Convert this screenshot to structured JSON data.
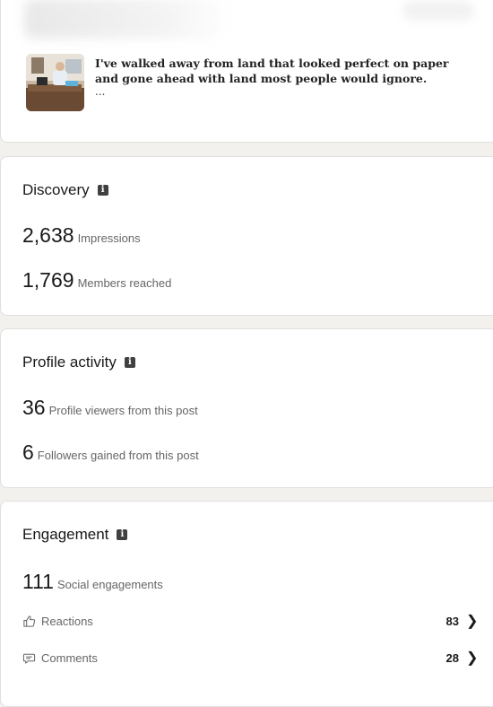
{
  "post": {
    "text": "I've walked away from land that looked perfect on paper and gone ahead with land most people would ignore.",
    "ellipsis": "..."
  },
  "discovery": {
    "title": "Discovery",
    "impressions_value": "2,638",
    "impressions_label": "Impressions",
    "members_value": "1,769",
    "members_label": "Members reached"
  },
  "profile_activity": {
    "title": "Profile activity",
    "viewers_value": "36",
    "viewers_label": "Profile viewers from this post",
    "followers_value": "6",
    "followers_label": "Followers gained from this post"
  },
  "engagement": {
    "title": "Engagement",
    "social_value": "111",
    "social_label": "Social engagements",
    "reactions_label": "Reactions",
    "reactions_count": "83",
    "comments_label": "Comments",
    "comments_count": "28"
  },
  "icons": {
    "info": "info-icon",
    "reactions": "thumbs-up-icon",
    "comments": "comment-bubble-icon",
    "chevron": "chevron-right-icon"
  }
}
